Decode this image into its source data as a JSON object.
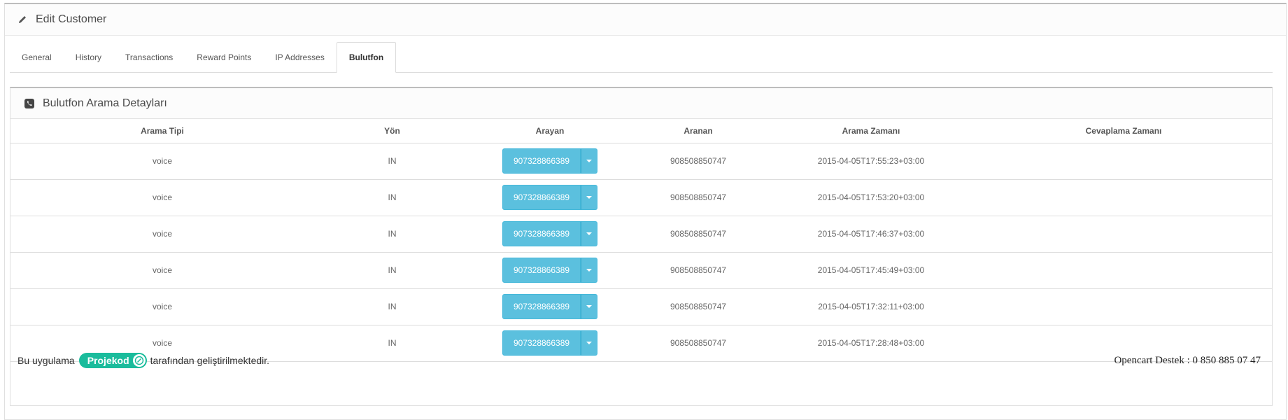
{
  "header": {
    "title": "Edit Customer",
    "icon": "pencil-icon"
  },
  "tabs": [
    {
      "label": "General",
      "active": false
    },
    {
      "label": "History",
      "active": false
    },
    {
      "label": "Transactions",
      "active": false
    },
    {
      "label": "Reward Points",
      "active": false
    },
    {
      "label": "IP Addresses",
      "active": false
    },
    {
      "label": "Bulutfon",
      "active": true
    }
  ],
  "panel": {
    "title": "Bulutfon Arama Detayları",
    "icon": "phone-icon"
  },
  "table": {
    "headers": [
      "Arama Tipi",
      "Yön",
      "Arayan",
      "Aranan",
      "Arama Zamanı",
      "Cevaplama Zamanı"
    ],
    "rows": [
      {
        "type": "voice",
        "direction": "IN",
        "caller": "907328866389",
        "callee": "908508850747",
        "time": "2015-04-05T17:55:23+03:00",
        "answer": ""
      },
      {
        "type": "voice",
        "direction": "IN",
        "caller": "907328866389",
        "callee": "908508850747",
        "time": "2015-04-05T17:53:20+03:00",
        "answer": ""
      },
      {
        "type": "voice",
        "direction": "IN",
        "caller": "907328866389",
        "callee": "908508850747",
        "time": "2015-04-05T17:46:37+03:00",
        "answer": ""
      },
      {
        "type": "voice",
        "direction": "IN",
        "caller": "907328866389",
        "callee": "908508850747",
        "time": "2015-04-05T17:45:49+03:00",
        "answer": ""
      },
      {
        "type": "voice",
        "direction": "IN",
        "caller": "907328866389",
        "callee": "908508850747",
        "time": "2015-04-05T17:32:11+03:00",
        "answer": ""
      },
      {
        "type": "voice",
        "direction": "IN",
        "caller": "907328866389",
        "callee": "908508850747",
        "time": "2015-04-05T17:28:48+03:00",
        "answer": ""
      }
    ]
  },
  "footer": {
    "prefix": "Bu uygulama",
    "brand": "Projekod",
    "suffix": "tarafından geliştirilmektedir.",
    "support": "Opencart Destek : 0 850 885 07 47"
  },
  "colors": {
    "button": "#5bc0de",
    "brand_badge": "#1abc9c"
  }
}
